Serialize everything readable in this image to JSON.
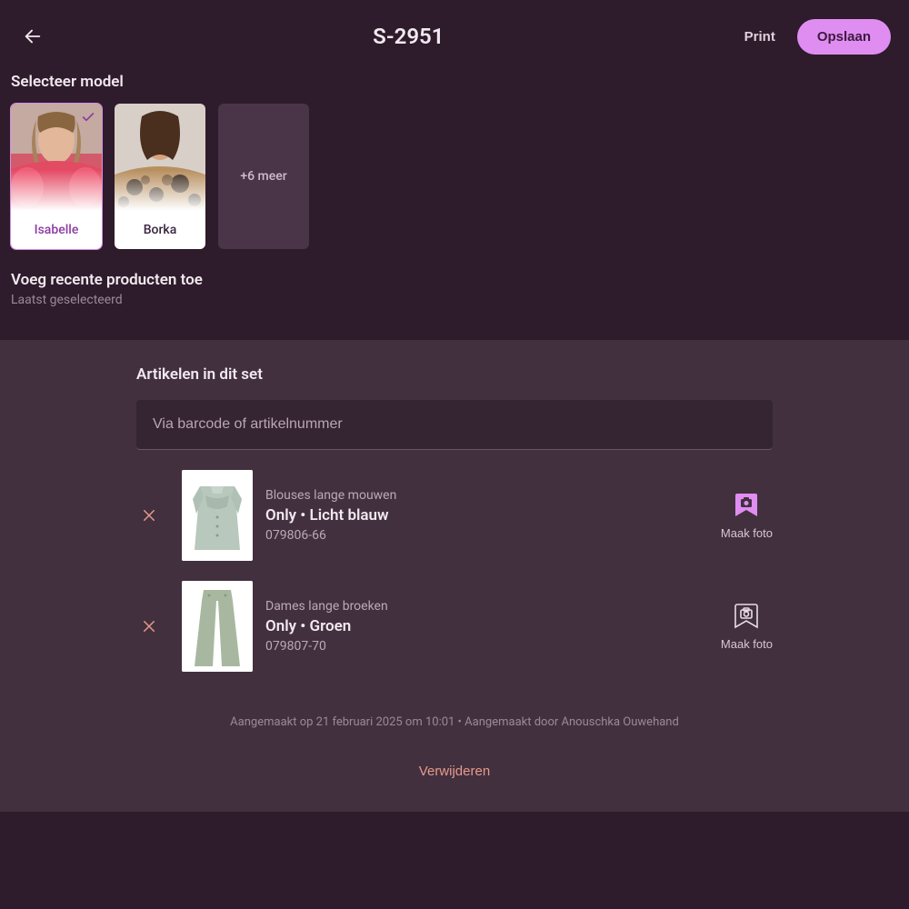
{
  "header": {
    "title": "S-2951",
    "print_label": "Print",
    "save_label": "Opslaan"
  },
  "models": {
    "section_title": "Selecteer model",
    "items": [
      {
        "name": "Isabelle",
        "selected": true
      },
      {
        "name": "Borka",
        "selected": false
      }
    ],
    "more_label": "+6 meer"
  },
  "recent": {
    "title": "Voeg recente producten toe",
    "subtitle": "Laatst geselecteerd"
  },
  "panel": {
    "title": "Artikelen in dit set",
    "search_placeholder": "Via barcode of artikelnummer",
    "photo_label": "Maak foto",
    "items": [
      {
        "category": "Blouses lange mouwen",
        "name": "Only • Licht blauw",
        "sku": "079806-66"
      },
      {
        "category": "Dames lange broeken",
        "name": "Only • Groen",
        "sku": "079807-70"
      }
    ],
    "meta": "Aangemaakt op 21 februari 2025 om 10:01 • Aangemaakt door Anouschka Ouwehand",
    "delete_label": "Verwijderen"
  },
  "icons": {
    "back": "arrow-left-icon",
    "check": "check-icon",
    "remove": "x-icon",
    "bookmark_camera": "bookmark-camera-icon"
  },
  "colors": {
    "accent": "#e08df2",
    "danger": "#e69a8a",
    "panel_bg": "#42303f",
    "page_bg": "#2e1b2b"
  }
}
